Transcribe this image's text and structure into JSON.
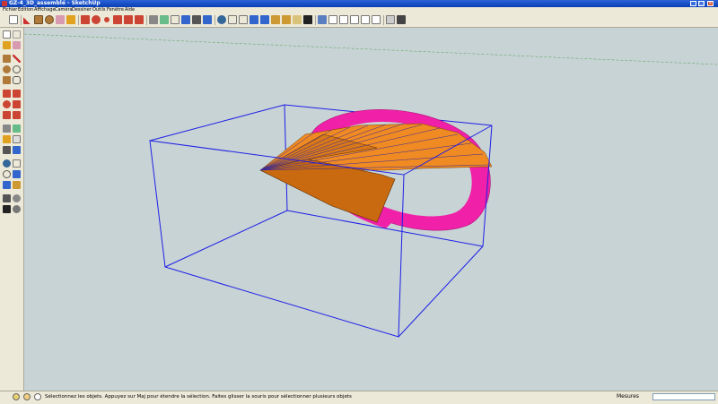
{
  "window": {
    "title": "GZ-4_3D_assemblé - SketchUp"
  },
  "menu": [
    "Fichier",
    "Edition",
    "Affichage",
    "Caméra",
    "Dessiner",
    "Outils",
    "Fenêtre",
    "Aide"
  ],
  "toolbar": {
    "icons": [
      "select-icon",
      "pencil-icon",
      "rectangle-icon",
      "circle-icon",
      "eraser-icon",
      "paint-bucket-icon",
      "push-pull-icon",
      "move-icon",
      "rotate-icon",
      "follow-me-icon",
      "scale-icon",
      "offset-icon",
      "tape-measure-icon",
      "dimension-icon",
      "protractor-icon",
      "text-icon",
      "axes-icon",
      "3d-text-icon",
      "orbit-icon",
      "pan-icon",
      "zoom-icon",
      "zoom-window-icon",
      "zoom-extents-icon",
      "previous-view-icon",
      "next-view-icon",
      "walk-icon",
      "look-around-icon",
      "position-camera-icon",
      "section-plane-icon",
      "components-icon",
      "materials-icon",
      "iso-view-icon",
      "top-view-icon",
      "front-view-icon",
      "right-view-icon",
      "back-view-icon",
      "left-view-icon",
      "xray-icon",
      "wireframe-icon",
      "hidden-line-icon",
      "shaded-icon",
      "shaded-textures-icon",
      "monochrome-icon"
    ]
  },
  "left_tools": [
    "select-icon",
    "make-component-icon",
    "paint-bucket-icon",
    "eraser-icon",
    "rectangle-icon",
    "line-icon",
    "circle-icon",
    "arc-icon",
    "polygon-icon",
    "freehand-icon",
    "move-icon",
    "push-pull-icon",
    "rotate-icon",
    "follow-me-icon",
    "scale-icon",
    "offset-icon",
    "tape-measure-icon",
    "dimension-icon",
    "protractor-icon",
    "text-icon",
    "axes-icon",
    "3d-text-icon",
    "orbit-icon",
    "pan-icon",
    "zoom-icon",
    "zoom-window-icon",
    "zoom-extents-icon",
    "previous-icon",
    "position-camera-icon",
    "walk-icon",
    "look-around-icon",
    "section-plane-icon"
  ],
  "status": {
    "text": "Sélectionnez les objets. Appuyez sur Maj pour étendre la sélection. Faites glisser la souris pour sélectionner plusieurs objets",
    "measure_label": "Mesures",
    "measure_value": ""
  },
  "colors": {
    "viewport_bg": "#c7d3d5",
    "bounding_box": "#1f1fe6",
    "magenta_surface": "#f020a8",
    "orange_surface": "#c96a10",
    "orange_light": "#f08a22",
    "axis_green": "#6aa96a"
  }
}
